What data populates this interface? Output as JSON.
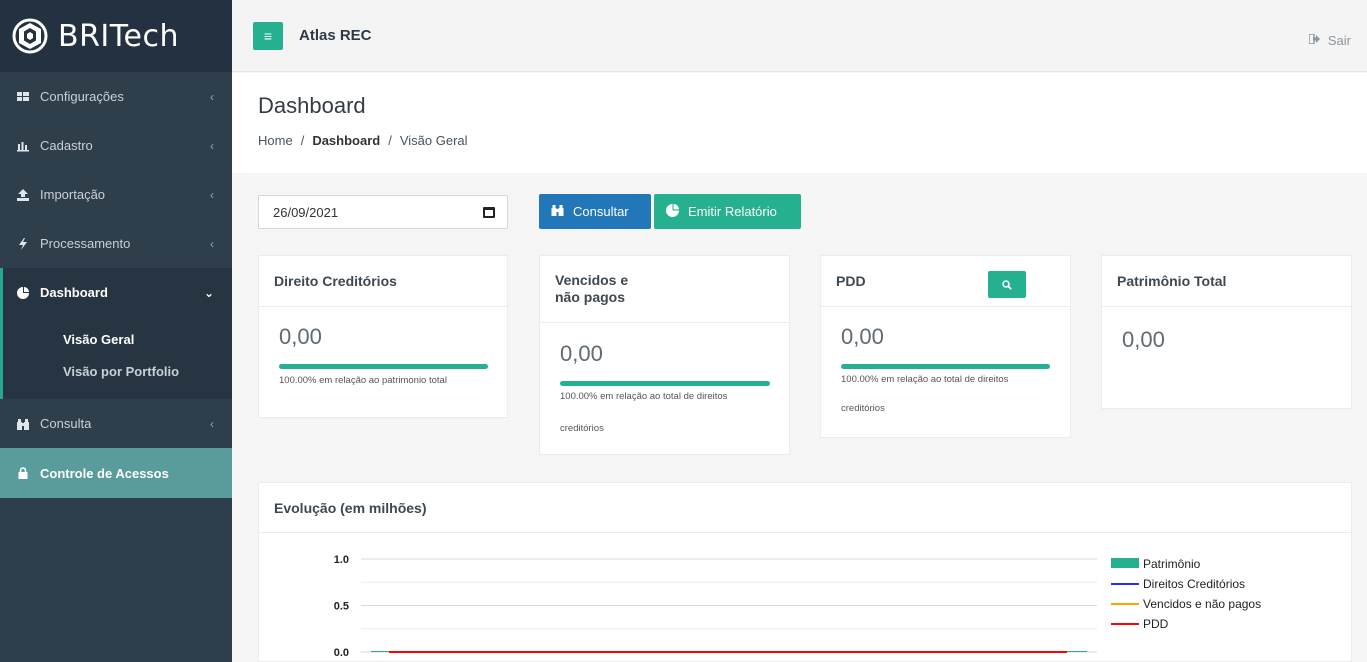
{
  "brand": {
    "name": "BRITech"
  },
  "sidebar": {
    "items": [
      {
        "label": "Configurações",
        "icon": "grid-icon"
      },
      {
        "label": "Cadastro",
        "icon": "bar-chart-icon"
      },
      {
        "label": "Importação",
        "icon": "upload-icon"
      },
      {
        "label": "Processamento",
        "icon": "bolt-icon"
      },
      {
        "label": "Dashboard",
        "icon": "pie-chart-icon"
      },
      {
        "label": "Consulta",
        "icon": "binoculars-icon"
      },
      {
        "label": "Controle de Acessos",
        "icon": "lock-icon"
      }
    ],
    "sub_items": [
      "Visão Geral",
      "Visão por Portfolio"
    ]
  },
  "topbar": {
    "app_name": "Atlas REC",
    "logout_label": "Sair"
  },
  "header": {
    "title": "Dashboard",
    "breadcrumb": {
      "home": "Home",
      "sep": "/",
      "section": "Dashboard",
      "page": "Visão Geral"
    }
  },
  "filters": {
    "date_value": "26/09/2021",
    "consultar_label": "Consultar",
    "relatorio_label": "Emitir Relatório"
  },
  "cards": {
    "direitos": {
      "title": "Direito Creditórios",
      "value": "0,00",
      "progress_pct": 100,
      "note": "100.00% em relação ao patrimonio total"
    },
    "vencidos": {
      "title_line1": "Vencidos e",
      "title_line2": "não pagos",
      "value": "0,00",
      "progress_pct": 100,
      "note_line1": "100.00% em relação ao total de direitos",
      "note_line2": "creditórios"
    },
    "pdd": {
      "title": "PDD",
      "value": "0,00",
      "progress_pct": 100,
      "note_line1": "100.00% em relação ao total de direitos",
      "note_line2": "creditórios"
    },
    "patrimonio": {
      "title": "Patrimônio Total",
      "value": "0,00"
    }
  },
  "chart_data": {
    "type": "line",
    "title": "Evolução (em milhões)",
    "y_ticks": [
      "1.0",
      "0.5",
      "0.0"
    ],
    "ylim": [
      0,
      1
    ],
    "grid": true,
    "legend_position": "right",
    "series": [
      {
        "name": "Patrimônio",
        "kind": "bar",
        "color": "#25b08f",
        "values": [
          0
        ]
      },
      {
        "name": "Direitos Creditórios",
        "kind": "line",
        "color": "#2b2bff",
        "values": [
          0
        ]
      },
      {
        "name": "Vencidos e não pagos",
        "kind": "line",
        "color": "#ffa500",
        "values": [
          0
        ]
      },
      {
        "name": "PDD",
        "kind": "line",
        "color": "#ff0000",
        "values": [
          0
        ]
      }
    ]
  }
}
